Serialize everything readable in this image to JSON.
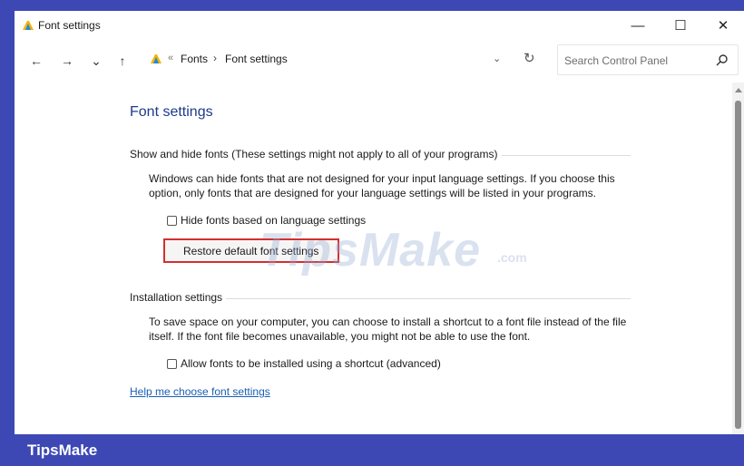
{
  "window": {
    "title": "Font settings"
  },
  "controls": {
    "minimize": "—",
    "maximize": "☐",
    "close": "✕"
  },
  "nav": {
    "back": "←",
    "forward": "→",
    "recent": "⌄",
    "up": "↑"
  },
  "address": {
    "separator": "«",
    "crumbs": [
      "Fonts",
      "Font settings"
    ],
    "crumb_sep": "›",
    "dropdown": "⌄",
    "refresh": "↻"
  },
  "search": {
    "placeholder": "Search Control Panel"
  },
  "main": {
    "title": "Font settings",
    "show_hide": {
      "label": "Show and hide fonts (These settings might not apply to all of your programs)",
      "description": "Windows can hide fonts that are not designed for your input language settings. If you choose this option, only fonts that are designed for your language settings will be listed in your programs.",
      "checkbox_label": "Hide fonts based on language settings",
      "checked": false,
      "restore_button": "Restore default font settings"
    },
    "installation": {
      "label": "Installation settings",
      "description": "To save space on your computer, you can choose to install a shortcut to a font file instead of the file itself. If the font file becomes unavailable, you might not be able to use the font.",
      "checkbox_label": "Allow fonts to be installed using a shortcut (advanced)",
      "checked": false
    },
    "help_link": "Help me choose font settings"
  },
  "watermark": {
    "text": "TipsMake",
    "suffix": ".com"
  },
  "footer": {
    "brand": "TipsMake"
  },
  "colors": {
    "frame": "#3d48b5",
    "title_blue": "#1e3a8a",
    "link": "#1a5fb4",
    "highlight": "#d32f2f"
  }
}
